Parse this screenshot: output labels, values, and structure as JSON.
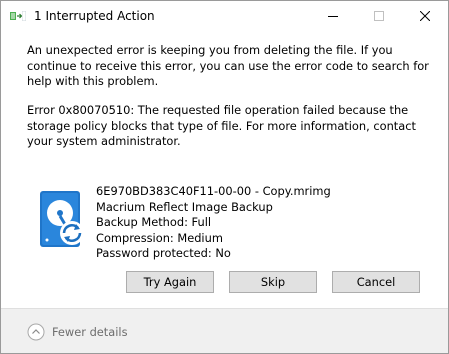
{
  "window": {
    "title": "1 Interrupted Action"
  },
  "titlebar": {
    "app_icon": "file-move-icon",
    "minimize_icon": "minimize-icon",
    "maximize_icon": "maximize-icon",
    "close_icon": "close-icon"
  },
  "message": {
    "primary": "An unexpected error is keeping you from deleting the file. If you continue to receive this error, you can use the error code to search for help with this problem.",
    "error": "Error 0x80070510: The requested file operation failed because the storage policy blocks that type of file. For more information, contact your system administrator."
  },
  "file": {
    "icon": "macrium-drive-icon",
    "name": "6E970BD383C40F11-00-00 - Copy.mrimg",
    "type": "Macrium Reflect Image Backup",
    "backup_method": "Backup Method: Full",
    "compression": "Compression: Medium",
    "password": "Password protected: No"
  },
  "buttons": {
    "try_again": "Try Again",
    "skip": "Skip",
    "cancel": "Cancel"
  },
  "footer": {
    "toggle_icon": "chevron-up-circle-icon",
    "label": "Fewer details"
  },
  "colors": {
    "button_bg": "#e1e1e1",
    "button_border": "#adadad",
    "footer_bg": "#f0f0f0",
    "footer_text": "#6d6d6d",
    "icon_blue": "#1f75c9"
  }
}
